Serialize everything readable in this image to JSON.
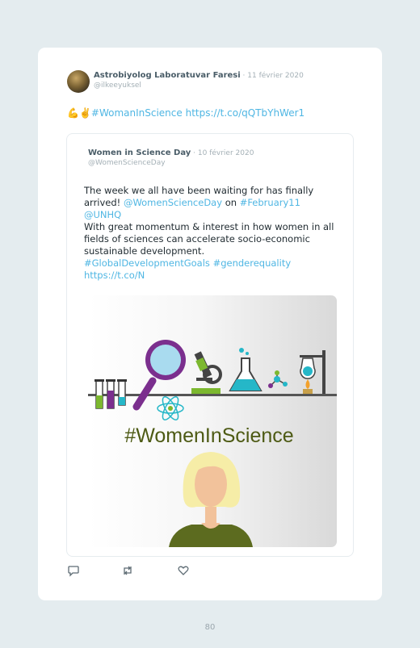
{
  "tweet": {
    "author_name": "Astrobiyolog Laboratuvar Faresi",
    "date": "11 février 2020",
    "handle": "@ilkeeyuksel",
    "emoji": "💪✌️",
    "hashtag": "#WomanInScience",
    "link": "https://t.co/qQTbYhWer1"
  },
  "quote": {
    "author_name": "Women in Science Day",
    "date": "10 février 2020",
    "handle": "@WomenScienceDay",
    "line1": "The week we all have been waiting for has finally",
    "line2_prefix": "arrived! ",
    "mention1": "@WomenScienceDay",
    "on_word": " on ",
    "hashtag_date": "#February11",
    "mention2": "@UNHQ",
    "line4": "With great momentum & interest in how women in all",
    "line5": "fields of sciences can accelerate socio-economic",
    "line6": "sustainable development.",
    "hashtags": "#GlobalDevelopmentGoals #genderequality",
    "link": "https://t.co/N",
    "image_caption": "#WomenInScience"
  },
  "colors": {
    "link": "#4fb6e3",
    "author": "#4a5d68",
    "muted": "#a4b0b6",
    "caption": "#4d5a14",
    "purple": "#7b2f8e",
    "teal": "#25b7c8",
    "green": "#7cb82f",
    "hair": "#f6eda7",
    "skin": "#f2c29b",
    "shirt": "#5c6b1f"
  },
  "icons": [
    "reply-icon",
    "retweet-icon",
    "like-icon",
    "magnifier-icon",
    "microscope-icon",
    "flask-icon",
    "atom-icon",
    "molecule-icon",
    "burner-icon",
    "test-tube-icon"
  ],
  "page_number": "80"
}
